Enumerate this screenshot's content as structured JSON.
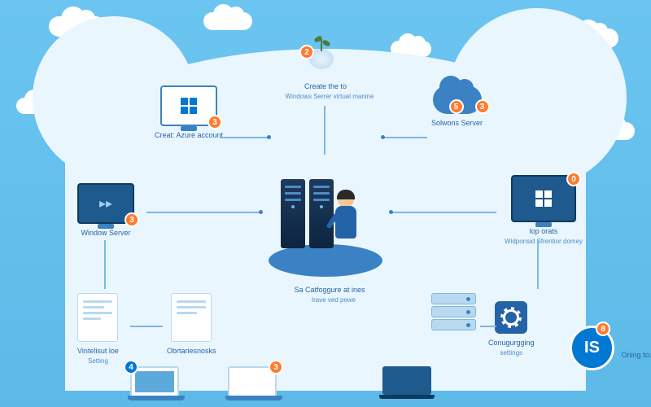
{
  "badges": {
    "top": "2",
    "azure": "3",
    "solutions1": "5",
    "solutions2": "3",
    "windows": "0",
    "bottom1": "4",
    "bottom2": "3",
    "right": "8"
  },
  "labels": {
    "top_main": "Create the to",
    "top_sub": "Windows Serrer virtual manine",
    "azure": "Creat: Azure account",
    "solutions": "Solwons Server",
    "windows_server": "Window Server",
    "right_main": "lop orats",
    "right_sub": "Widponsid Sfrentior domey",
    "center_main": "Sa Catfoggure at ines",
    "center_sub": "Irave ved pewe",
    "bl1": "Vintelisut loe",
    "bl1_sub": "Setting",
    "bl2": "Obrtariesnosks",
    "br1": "Conugurgging",
    "br1_sub": "settings",
    "br2": "Oning tcupke",
    "is": "IS"
  }
}
